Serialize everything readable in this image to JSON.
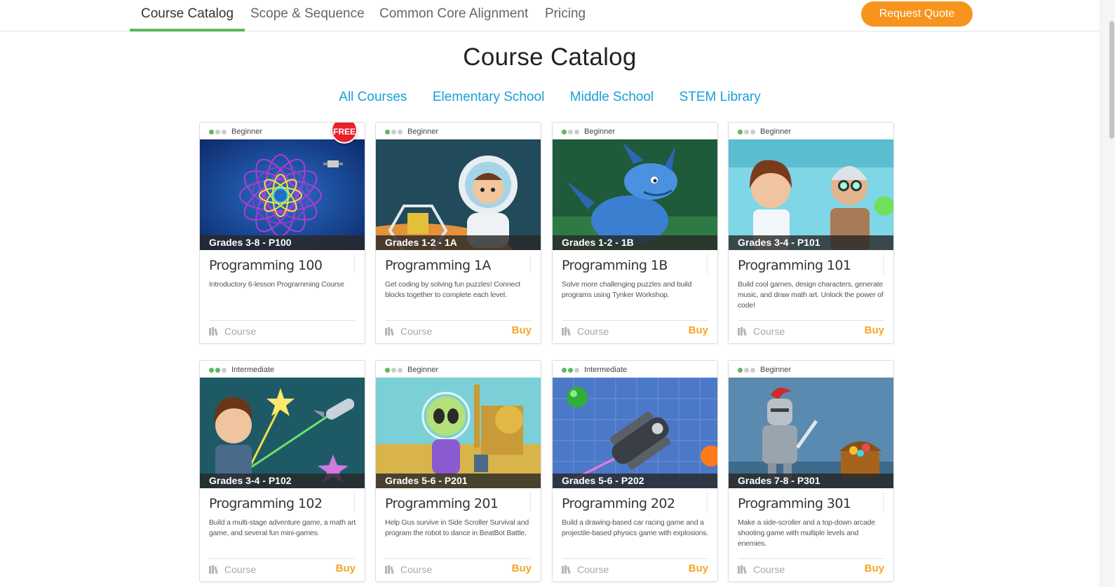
{
  "nav": {
    "tabs": [
      "Course Catalog",
      "Scope & Sequence",
      "Common Core Alignment",
      "Pricing"
    ],
    "active_tab": "Course Catalog",
    "cta_label": "Request Quote"
  },
  "page": {
    "title": "Course Catalog",
    "filters": [
      "All Courses",
      "Elementary School",
      "Middle School",
      "STEM Library"
    ]
  },
  "colors": {
    "accent_green": "#5cb85c",
    "cta_orange": "#f7941d",
    "link_blue": "#1a9fd9",
    "buy_orange": "#f5a623",
    "free_badge_red": "#e8202a"
  },
  "courses": [
    {
      "level": "Beginner",
      "level_dots": 1,
      "badge": "FREE",
      "grade": "Grades 3-8 - P100",
      "title": "Programming 100",
      "desc": "Introductory 6-lesson Programming Course",
      "type": "Course",
      "buy": "",
      "art": "mandala"
    },
    {
      "level": "Beginner",
      "level_dots": 1,
      "badge": "",
      "grade": "Grades 1-2 - 1A",
      "title": "Programming 1A",
      "desc": "Get coding by solving fun puzzles! Connect blocks together to complete each level.",
      "type": "Course",
      "buy": "Buy",
      "art": "astronaut"
    },
    {
      "level": "Beginner",
      "level_dots": 1,
      "badge": "",
      "grade": "Grades 1-2 - 1B",
      "title": "Programming 1B",
      "desc": "Solve more challenging puzzles and build programs using Tynker Workshop.",
      "type": "Course",
      "buy": "Buy",
      "art": "dragon"
    },
    {
      "level": "Beginner",
      "level_dots": 1,
      "badge": "",
      "grade": "Grades 3-4 - P101",
      "title": "Programming 101",
      "desc": "Build cool games, design characters, generate music, and draw math art. Unlock the power of code!",
      "type": "Course",
      "buy": "Buy",
      "art": "scientists"
    },
    {
      "level": "Intermediate",
      "level_dots": 2,
      "badge": "",
      "grade": "Grades 3-4 - P102",
      "title": "Programming 102",
      "desc": "Build a multi-stage adventure game, a math art game, and several fun mini-games.",
      "type": "Course",
      "buy": "Buy",
      "art": "space-girl"
    },
    {
      "level": "Beginner",
      "level_dots": 1,
      "badge": "",
      "grade": "Grades 5-6 - P201",
      "title": "Programming 201",
      "desc": "Help Gus survive in Side Scroller Survival and program the robot to dance in BeatBot Battle.",
      "type": "Course",
      "buy": "Buy",
      "art": "alien"
    },
    {
      "level": "Intermediate",
      "level_dots": 2,
      "badge": "",
      "grade": "Grades 5-6 - P202",
      "title": "Programming 202",
      "desc": "Build a drawing-based car racing game and a projectile-based physics game with explosions.",
      "type": "Course",
      "buy": "Buy",
      "art": "spaceship"
    },
    {
      "level": "Beginner",
      "level_dots": 1,
      "badge": "",
      "grade": "Grades 7-8 - P301",
      "title": "Programming 301",
      "desc": "Make a side-scroller and a top-down arcade shooting game with multiple levels and enemies.",
      "type": "Course",
      "buy": "Buy",
      "art": "knight"
    }
  ]
}
